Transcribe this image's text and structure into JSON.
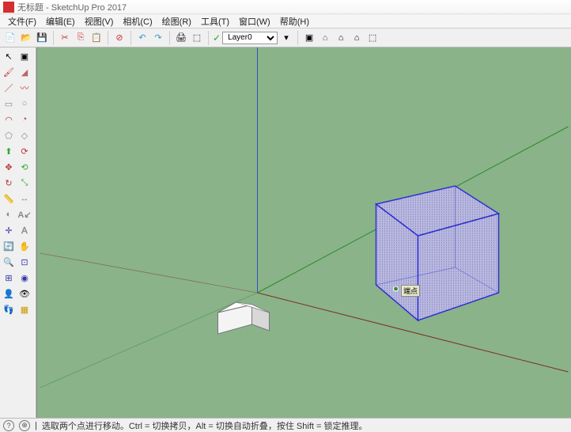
{
  "title": "无标题 - SketchUp Pro 2017",
  "menu": {
    "file": "文件(F)",
    "edit": "编辑(E)",
    "view": "视图(V)",
    "camera": "相机(C)",
    "draw": "绘图(R)",
    "tools": "工具(T)",
    "window": "窗口(W)",
    "help": "帮助(H)"
  },
  "toolbar": {
    "layer_label": "Layer0"
  },
  "viewport": {
    "endpoint_hint": "端点"
  },
  "status": {
    "hint": "选取两个点进行移动。Ctrl = 切换拷贝，Alt = 切换自动折叠，按住 Shift = 锁定推理。"
  },
  "icons": {
    "new": "📄",
    "open": "📂",
    "save": "💾",
    "cut": "✂",
    "copy": "⎘",
    "paste": "📋",
    "undo": "↶",
    "redo": "↷",
    "print": "🖨",
    "model": "⬚",
    "db1": "▣",
    "db2": "⌂",
    "db3": "⌂",
    "db4": "⌂",
    "db5": "⬚",
    "select": "↖",
    "eraser": "⌫",
    "line": "／",
    "freehand": "〰",
    "rect": "▭",
    "circle": "○",
    "arc": "◠",
    "pie": "◔",
    "polygon": "⬠",
    "offset": "⟳",
    "push": "⬆",
    "follow": "↻",
    "move": "✥",
    "rotate": "⟲",
    "scale": "⤡",
    "tape": "📏",
    "protractor": "◐",
    "text": "A",
    "axes": "✛",
    "dim": "↔",
    "paint": "🪣",
    "3dtext": "Ａ",
    "orbit": "🔄",
    "pan": "✋",
    "zoom": "🔍",
    "zoomext": "⊡",
    "prev": "◀",
    "next": "▶",
    "section": "▦",
    "walk": "👣",
    "look": "👁",
    "pos": "📍"
  }
}
